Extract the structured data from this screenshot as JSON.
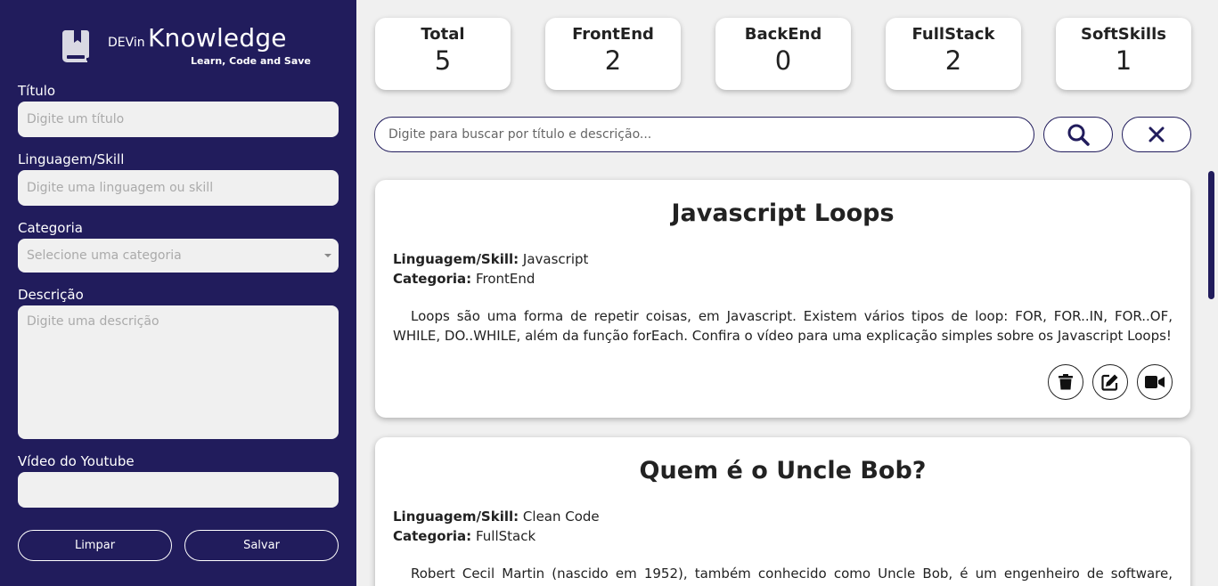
{
  "brand": {
    "prefix": "DEVin",
    "name": "Knowledge",
    "tagline": "Learn, Code and Save"
  },
  "form": {
    "title_label": "Título",
    "title_placeholder": "Digite um título",
    "skill_label": "Linguagem/Skill",
    "skill_placeholder": "Digite uma linguagem ou skill",
    "category_label": "Categoria",
    "category_placeholder": "Selecione uma categoria",
    "description_label": "Descrição",
    "description_placeholder": "Digite uma descrição",
    "video_label": "Vídeo do Youtube",
    "video_value": "",
    "clear_label": "Limpar",
    "save_label": "Salvar"
  },
  "stats": [
    {
      "label": "Total",
      "value": "5"
    },
    {
      "label": "FrontEnd",
      "value": "2"
    },
    {
      "label": "BackEnd",
      "value": "0"
    },
    {
      "label": "FullStack",
      "value": "2"
    },
    {
      "label": "SoftSkills",
      "value": "1"
    }
  ],
  "search": {
    "placeholder": "Digite para buscar por título e descrição..."
  },
  "cards": [
    {
      "title": "Javascript Loops",
      "skill_label": "Linguagem/Skill:",
      "skill": "Javascript",
      "category_label": "Categoria:",
      "category": "FrontEnd",
      "description": "Loops são uma forma de repetir coisas, em Javascript. Existem vários tipos de loop: FOR, FOR..IN, FOR..OF, WHILE, DO..WHILE, além da função forEach. Confira o vídeo para uma explicação simples sobre os Javascript Loops!"
    },
    {
      "title": "Quem é o Uncle Bob?",
      "skill_label": "Linguagem/Skill:",
      "skill": "Clean Code",
      "category_label": "Categoria:",
      "category": "FullStack",
      "description": "Robert Cecil Martin (nascido em 1952), também conhecido como Uncle Bob, é um engenheiro de software, professor e"
    }
  ],
  "icons": {
    "logo": "book-bookmark-icon",
    "search": "search-icon",
    "clear": "close-icon",
    "delete": "trash-icon",
    "edit": "edit-icon",
    "video": "video-camera-icon"
  },
  "colors": {
    "sidebar": "#211c5c",
    "background": "#f0f0f0",
    "card": "#ffffff"
  }
}
